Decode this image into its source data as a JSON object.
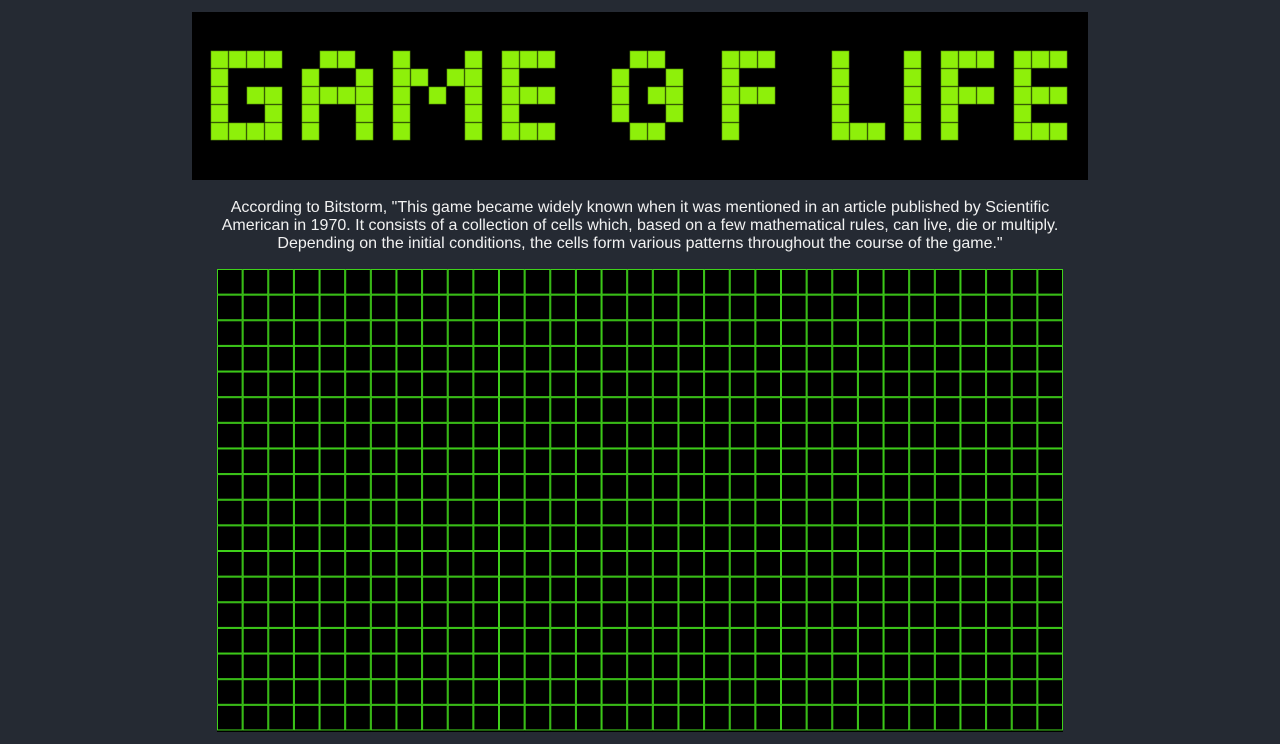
{
  "title": {
    "text": "GAME OF LIFE",
    "logo_color": "#8ef00a"
  },
  "description": "According to Bitstorm, \"This game became widely known when it was mentioned in an article published by Scientific American in 1970. It consists of a collection of cells which, based on a few mathematical rules, can live, die or multiply. Depending on the initial conditions, the cells form various patterns throughout the course of the game.\"",
  "board": {
    "columns": 33,
    "visible_rows": 18,
    "live_cells": [],
    "grid_color": "#3fd11a",
    "dead_cell_color": "#000000",
    "live_cell_color": "#8ef00a"
  },
  "colors": {
    "page_background": "#252a33",
    "text": "#f1f1f1"
  }
}
